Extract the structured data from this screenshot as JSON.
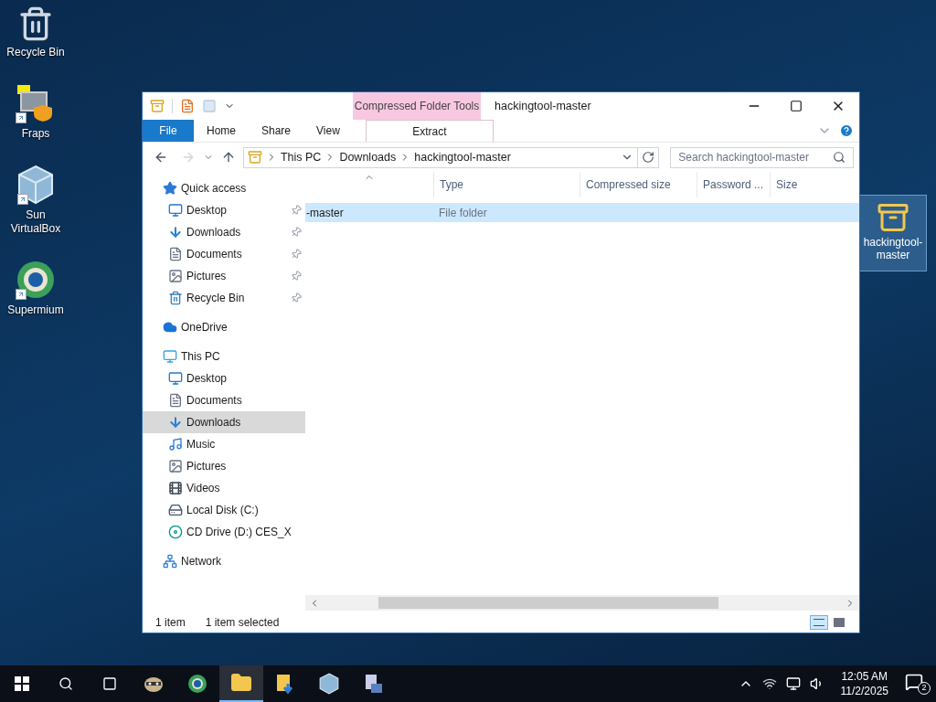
{
  "desktop_icons": [
    {
      "label": "Recycle Bin",
      "kind": "recycle",
      "shortcut": false
    },
    {
      "label": "Fraps",
      "kind": "fraps",
      "shortcut": true
    },
    {
      "label": "Sun VirtualBox",
      "kind": "vbox",
      "shortcut": true
    },
    {
      "label": "Supermium",
      "kind": "browser",
      "shortcut": true
    }
  ],
  "desktop_folder": {
    "label": "hackingtool-master",
    "selected": true
  },
  "window": {
    "title": "hackingtool-master",
    "contextual_group": "Compressed Folder Tools",
    "ribbon_tabs": [
      {
        "label": "File",
        "kind": "file",
        "selected": false
      },
      {
        "label": "Home",
        "kind": "tab",
        "selected": false
      },
      {
        "label": "Share",
        "kind": "tab",
        "selected": false
      },
      {
        "label": "View",
        "kind": "tab",
        "selected": false
      },
      {
        "label": "Extract",
        "kind": "contextual",
        "selected": true
      }
    ],
    "breadcrumbs": [
      "This PC",
      "Downloads",
      "hackingtool-master"
    ],
    "search_placeholder": "Search hackingtool-master",
    "nav": [
      {
        "label": "Quick access",
        "kind": "star",
        "selected": false,
        "children": [
          {
            "label": "Desktop",
            "kind": "desktop",
            "pinned": true,
            "selected": false
          },
          {
            "label": "Downloads",
            "kind": "download",
            "pinned": true,
            "selected": false
          },
          {
            "label": "Documents",
            "kind": "document",
            "pinned": true,
            "selected": false
          },
          {
            "label": "Pictures",
            "kind": "picture",
            "pinned": true,
            "selected": false
          },
          {
            "label": "Recycle Bin",
            "kind": "recycle",
            "pinned": true,
            "selected": false
          }
        ]
      },
      {
        "label": "OneDrive",
        "kind": "cloud",
        "selected": false
      },
      {
        "label": "This PC",
        "kind": "pc",
        "selected": false,
        "children": [
          {
            "label": "Desktop",
            "kind": "desktop",
            "pinned": false,
            "selected": false
          },
          {
            "label": "Documents",
            "kind": "document",
            "pinned": false,
            "selected": false
          },
          {
            "label": "Downloads",
            "kind": "download",
            "pinned": false,
            "selected": true
          },
          {
            "label": "Music",
            "kind": "music",
            "pinned": false,
            "selected": false
          },
          {
            "label": "Pictures",
            "kind": "picture",
            "pinned": false,
            "selected": false
          },
          {
            "label": "Videos",
            "kind": "video",
            "pinned": false,
            "selected": false
          },
          {
            "label": "Local Disk (C:)",
            "kind": "disk",
            "pinned": false,
            "selected": false
          },
          {
            "label": "CD Drive (D:) CES_X",
            "kind": "cd",
            "pinned": false,
            "selected": false
          }
        ]
      },
      {
        "label": "Network",
        "kind": "network",
        "selected": false
      }
    ],
    "columns": [
      "Type",
      "Compressed size",
      "Password ...",
      "Size"
    ],
    "rows": [
      {
        "name": "-master",
        "type": "File folder",
        "selected": true
      }
    ],
    "status": [
      "1 item",
      "1 item selected"
    ]
  },
  "taskbar": {
    "apps": [
      {
        "kind": "raccoon",
        "active": false
      },
      {
        "kind": "browser",
        "active": false
      },
      {
        "kind": "explorer",
        "active": true
      },
      {
        "kind": "downloads",
        "active": false
      },
      {
        "kind": "vbox",
        "active": false
      },
      {
        "kind": "setup",
        "active": false
      }
    ],
    "time": "12:05 AM",
    "date": "11/2/2025",
    "notifications": "2"
  }
}
